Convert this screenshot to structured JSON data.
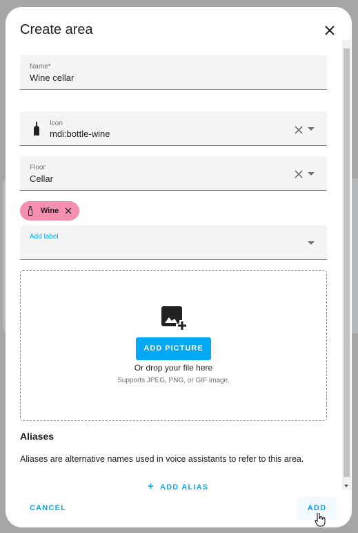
{
  "dialog": {
    "title": "Create area",
    "close_icon": "close-icon"
  },
  "name_field": {
    "label": "Name*",
    "value": "Wine cellar"
  },
  "icon_field": {
    "label": "Icon",
    "value": "mdi:bottle-wine",
    "icon": "bottle-wine-icon"
  },
  "floor_field": {
    "label": "Floor",
    "value": "Cellar"
  },
  "labels": {
    "chips": [
      {
        "label": "Wine",
        "color": "#f48fb1"
      }
    ],
    "add_label": "Add label"
  },
  "picture": {
    "button": "ADD PICTURE",
    "drop_text": "Or drop your file here",
    "support_text": "Supports JPEG, PNG, or GIF image."
  },
  "aliases": {
    "heading": "Aliases",
    "description": "Aliases are alternative names used in voice assistants to refer to this area.",
    "add_alias": "ADD ALIAS"
  },
  "footer": {
    "cancel": "CANCEL",
    "add": "ADD"
  },
  "colors": {
    "accent": "#03a9f4"
  }
}
